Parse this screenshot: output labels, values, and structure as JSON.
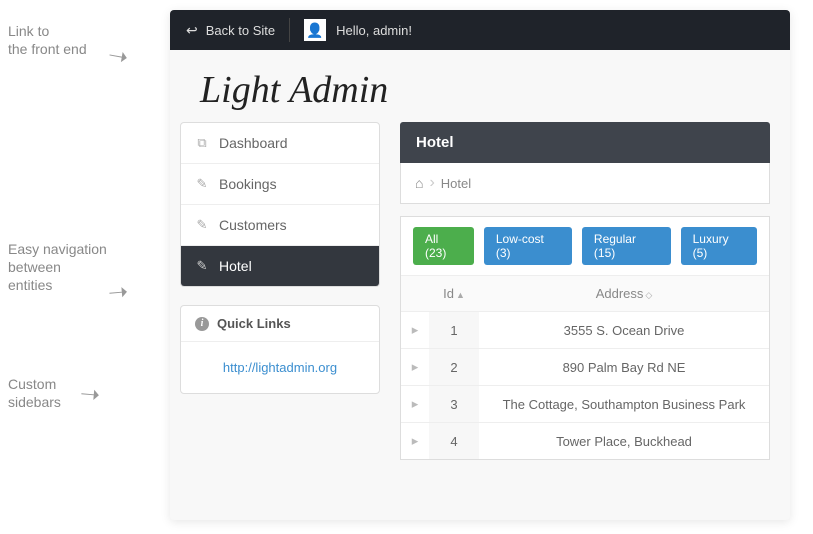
{
  "annotations": {
    "a1": "Link to\nthe front end",
    "a2": "Easy navigation\nbetween\nentities",
    "a3": "Custom\nsidebars"
  },
  "topbar": {
    "back_label": "Back to Site",
    "greeting": "Hello, admin!"
  },
  "brand": "Light Admin",
  "nav": {
    "items": [
      {
        "label": "Dashboard",
        "icon": "⧉"
      },
      {
        "label": "Bookings",
        "icon": "✎"
      },
      {
        "label": "Customers",
        "icon": "✎"
      },
      {
        "label": "Hotel",
        "icon": "✎"
      }
    ]
  },
  "quicklinks": {
    "title": "Quick Links",
    "link_text": "http://lightadmin.org"
  },
  "panel": {
    "title": "Hotel"
  },
  "breadcrumb": {
    "current": "Hotel"
  },
  "filters": [
    {
      "label": "All (23)",
      "color": "green"
    },
    {
      "label": "Low-cost (3)",
      "color": "blue"
    },
    {
      "label": "Regular (15)",
      "color": "blue"
    },
    {
      "label": "Luxury (5)",
      "color": "blue"
    }
  ],
  "table": {
    "headers": {
      "id": "Id",
      "address": "Address"
    },
    "rows": [
      {
        "id": "1",
        "address": "3555 S. Ocean Drive"
      },
      {
        "id": "2",
        "address": "890 Palm Bay Rd NE"
      },
      {
        "id": "3",
        "address": "The Cottage, Southampton Business Park"
      },
      {
        "id": "4",
        "address": "Tower Place, Buckhead"
      }
    ]
  }
}
